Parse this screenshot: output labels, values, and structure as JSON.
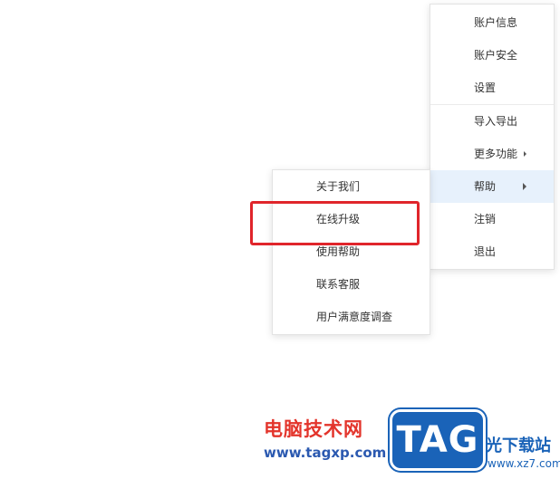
{
  "main_menu": {
    "items": [
      {
        "label": "账户信息"
      },
      {
        "label": "账户安全"
      },
      {
        "label": "设置"
      },
      {
        "label": "导入导出"
      },
      {
        "label": "更多功能"
      },
      {
        "label": "帮助"
      },
      {
        "label": "注销"
      },
      {
        "label": "退出"
      }
    ],
    "active_item": "帮助"
  },
  "help_submenu": {
    "items": [
      {
        "label": "关于我们"
      },
      {
        "label": "在线升级"
      },
      {
        "label": "使用帮助"
      },
      {
        "label": "联系客服"
      },
      {
        "label": "用户满意度调查"
      }
    ],
    "highlighted_item": "在线升级"
  },
  "watermark": {
    "title": "电脑技术网",
    "url": "www.tagxp.com",
    "logo_text": "TAG",
    "right_text": "光下载站",
    "right_url": "www.xz7.com"
  },
  "colors": {
    "highlight_border": "#e0252b",
    "active_item_bg": "#e7f1fc",
    "watermark_red": "#e3342b",
    "watermark_blue": "#1a63b8"
  }
}
